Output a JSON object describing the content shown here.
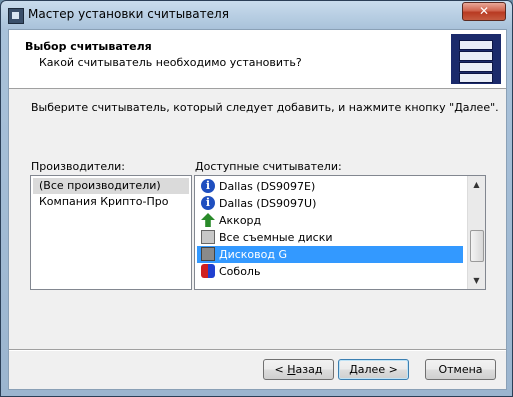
{
  "window": {
    "title": "Мастер установки считывателя",
    "close_glyph": "✕"
  },
  "header": {
    "title": "Выбор считывателя",
    "subtitle": "Какой считыватель необходимо установить?",
    "icon": "card-reader-stack-icon"
  },
  "instruction": "Выберите считыватель, который следует добавить, и нажмите кнопку \"Далее\".",
  "manufacturers": {
    "label": "Производители:",
    "items": [
      {
        "label": "(Все производители)",
        "selected": true
      },
      {
        "label": "Компания Крипто-Про",
        "selected": false
      }
    ]
  },
  "readers": {
    "label": "Доступные считыватели:",
    "items": [
      {
        "label": "Dallas (DS9097E)",
        "icon": "info-icon"
      },
      {
        "label": "Dallas (DS9097U)",
        "icon": "info-icon"
      },
      {
        "label": "Аккорд",
        "icon": "green-arrow-icon"
      },
      {
        "label": "Все съемные диски",
        "icon": "removable-disk-icon"
      },
      {
        "label": "Дисковод G",
        "icon": "floppy-drive-icon",
        "selected": true
      },
      {
        "label": "Соболь",
        "icon": "sobol-card-icon"
      }
    ]
  },
  "buttons": {
    "back_pre": "< ",
    "back_u": "Н",
    "back_post": "азад",
    "next_u": "Д",
    "next_post": "алее >",
    "cancel": "Отмена"
  }
}
